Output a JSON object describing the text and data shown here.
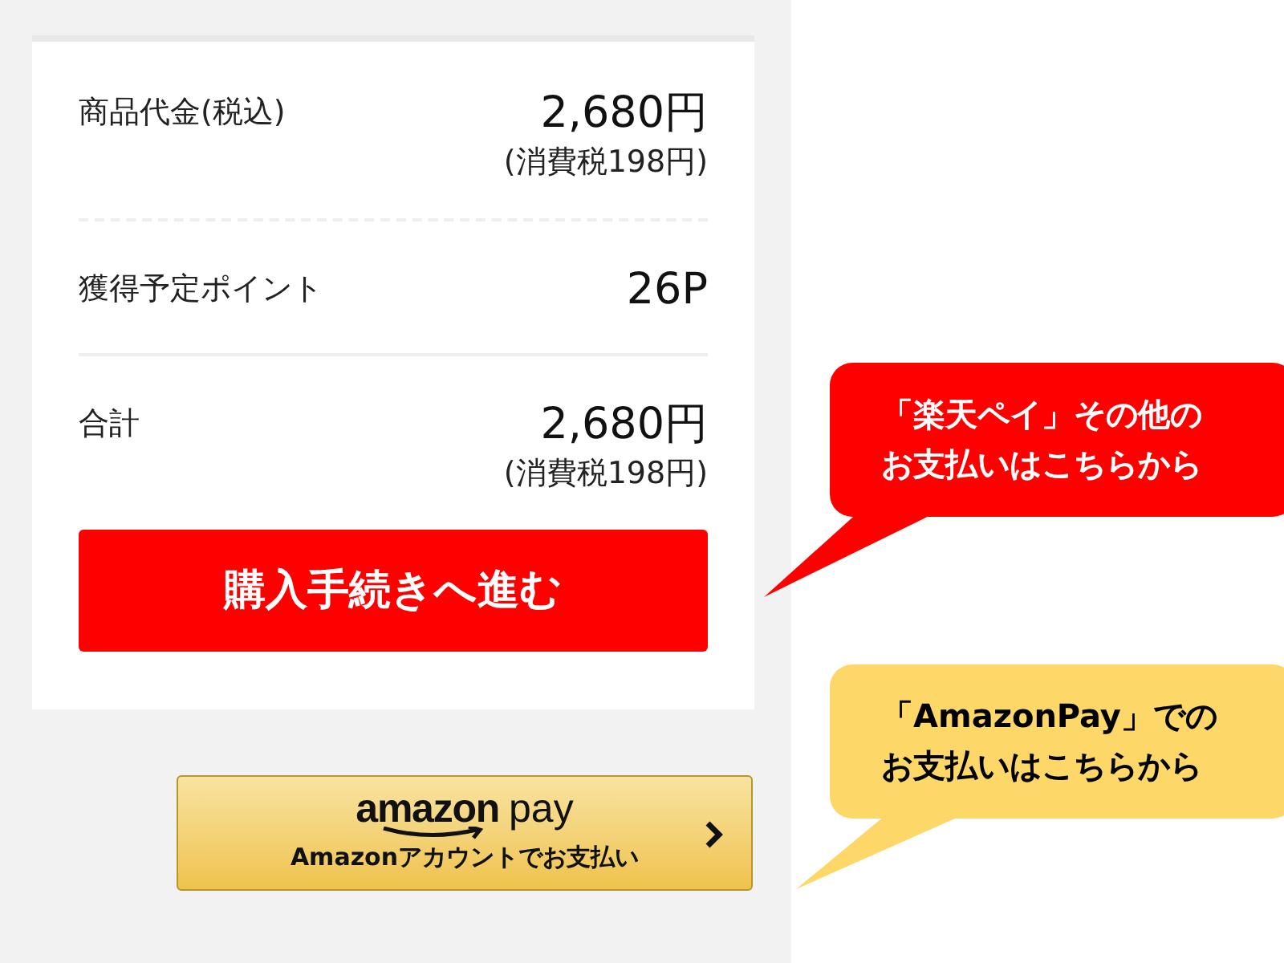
{
  "summary": {
    "rows": [
      {
        "label": "商品代金(税込)",
        "value": "2,680円",
        "note": "(消費税198円)",
        "kind": "dashed"
      },
      {
        "label": "獲得予定ポイント",
        "value": "26P",
        "kind": "solid"
      },
      {
        "label": "合計",
        "value": "2,680円",
        "note": "(消費税198円)",
        "kind": "plain"
      }
    ],
    "checkout_button": "購入手続きへ進む"
  },
  "amazon_pay_button": {
    "logo_word": "amazon",
    "logo_suffix": "pay",
    "caption": "Amazonアカウントでお支払い"
  },
  "callouts": [
    {
      "lines": [
        "「楽天ペイ」その他の",
        "お支払いはこちらから"
      ],
      "color": "#ff0000"
    },
    {
      "lines": [
        "「AmazonPay」での",
        "お支払いはこちらから"
      ],
      "color": "#fdd868"
    }
  ]
}
